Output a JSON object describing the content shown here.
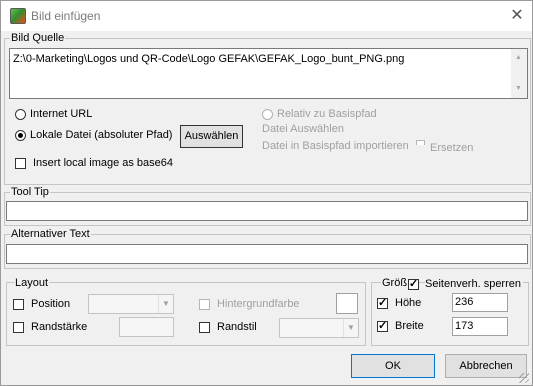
{
  "window": {
    "title": "Bild einfügen",
    "close_glyph": "✕"
  },
  "bild_quelle": {
    "legend": "Bild Quelle",
    "path_value": "Z:\\0-Marketing\\Logos und QR-Code\\Logo GEFAK\\GEFAK_Logo_bunt_PNG.png",
    "internet_url_label": "Internet URL",
    "lokale_datei_label": "Lokale Datei (absoluter Pfad)",
    "auswaehlen_button": "Auswählen",
    "relativ_label": "Relativ zu Basispfad",
    "datei_auswaehlen_label": "Datei Auswählen",
    "datei_importieren_label": "Datei in Basispfad importieren",
    "ersetzen_label": "Ersetzen",
    "base64_label": "Insert local image as base64",
    "selected_source": "lokale_datei"
  },
  "tool_tip": {
    "legend": "Tool Tip",
    "value": ""
  },
  "alt_text": {
    "legend": "Alternativer Text",
    "value": ""
  },
  "layout": {
    "legend": "Layout",
    "position_label": "Position",
    "randstaerke_label": "Randstärke",
    "hintergrundfarbe_label": "Hintergrundfarbe",
    "randstil_label": "Randstil"
  },
  "groesse": {
    "legend": "Größ",
    "seitenverh_label": "Seitenverh. sperren",
    "hoehe_label": "Höhe",
    "hoehe_value": "236",
    "breite_label": "Breite",
    "breite_value": "173"
  },
  "buttons": {
    "ok": "OK",
    "abbrechen": "Abbrechen"
  }
}
